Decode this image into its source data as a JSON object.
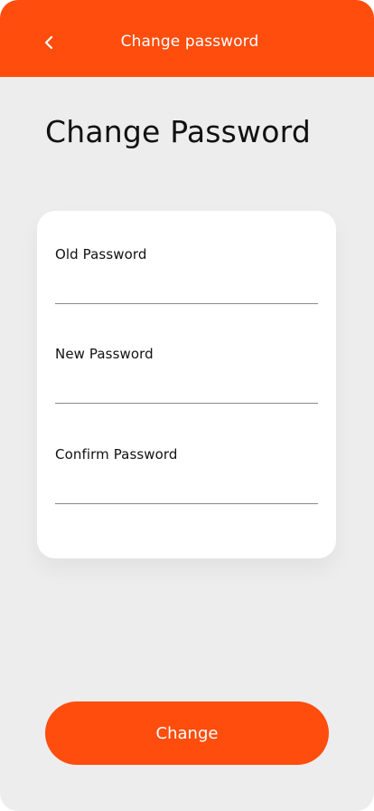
{
  "header": {
    "title": "Change password",
    "back_icon": "chevron-left-icon"
  },
  "page": {
    "title": "Change Password"
  },
  "form": {
    "fields": [
      {
        "label": "Old Password",
        "value": "",
        "placeholder": ""
      },
      {
        "label": "New Password",
        "value": "",
        "placeholder": ""
      },
      {
        "label": "Confirm Password",
        "value": "",
        "placeholder": ""
      }
    ]
  },
  "actions": {
    "change_label": "Change"
  },
  "colors": {
    "accent": "#ff4d0d",
    "background": "#ededed",
    "card": "#ffffff"
  }
}
